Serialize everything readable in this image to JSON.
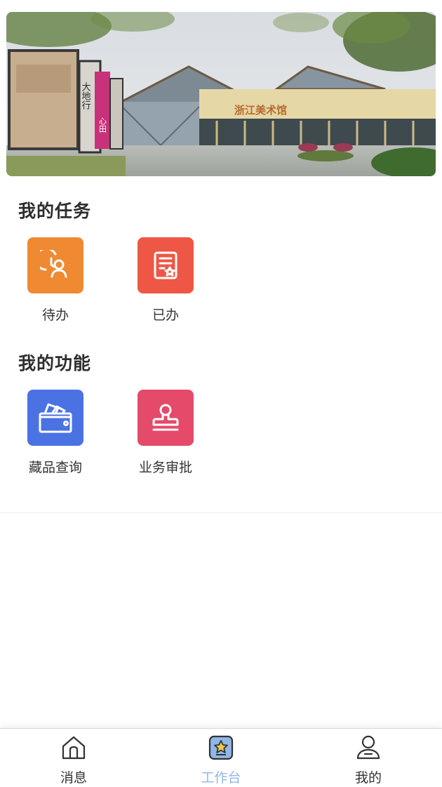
{
  "banner": {
    "sign_text": "浙江美术馆",
    "board_text_1": "大地行",
    "board_text_2": "心田"
  },
  "tasks": {
    "title": "我的任务",
    "items": [
      {
        "label": "待办",
        "icon": "user-clock-icon",
        "color": "#ef8a33"
      },
      {
        "label": "已办",
        "icon": "document-star-icon",
        "color": "#ee5745"
      }
    ]
  },
  "functions": {
    "title": "我的功能",
    "items": [
      {
        "label": "藏品查询",
        "icon": "wallet-icon",
        "color": "#4a72e3"
      },
      {
        "label": "业务审批",
        "icon": "stamp-icon",
        "color": "#e54a6a"
      }
    ]
  },
  "tabbar": {
    "items": [
      {
        "label": "消息",
        "icon": "home-icon",
        "active": false
      },
      {
        "label": "工作台",
        "icon": "workbench-star-icon",
        "active": true
      },
      {
        "label": "我的",
        "icon": "user-icon",
        "active": false
      }
    ],
    "active_color": "#8fb8e8"
  }
}
